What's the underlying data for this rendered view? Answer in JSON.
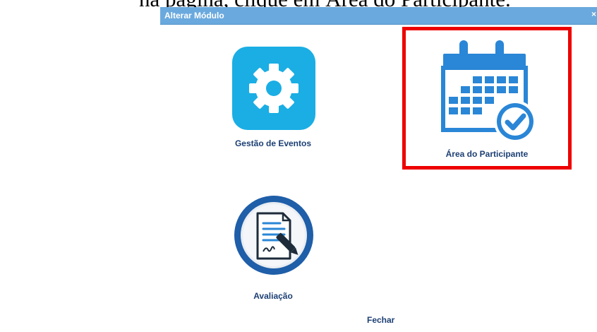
{
  "caption": {
    "text": "na página, clique em Área do Participante."
  },
  "dialog": {
    "title": "Alterar Módulo",
    "close_label": "×",
    "close_button_label": "Fechar"
  },
  "modules": [
    {
      "label": "Gestão de Eventos",
      "icon": "gear-icon",
      "color": "#1aaee4"
    },
    {
      "label": "Área do Participante",
      "icon": "calendar-check-icon",
      "color": "#2a86d6",
      "highlighted": true,
      "highlight_color": "#ee0000"
    },
    {
      "label": "Avaliação",
      "icon": "evaluation-document-icon",
      "color": "#1f5ea8"
    }
  ]
}
